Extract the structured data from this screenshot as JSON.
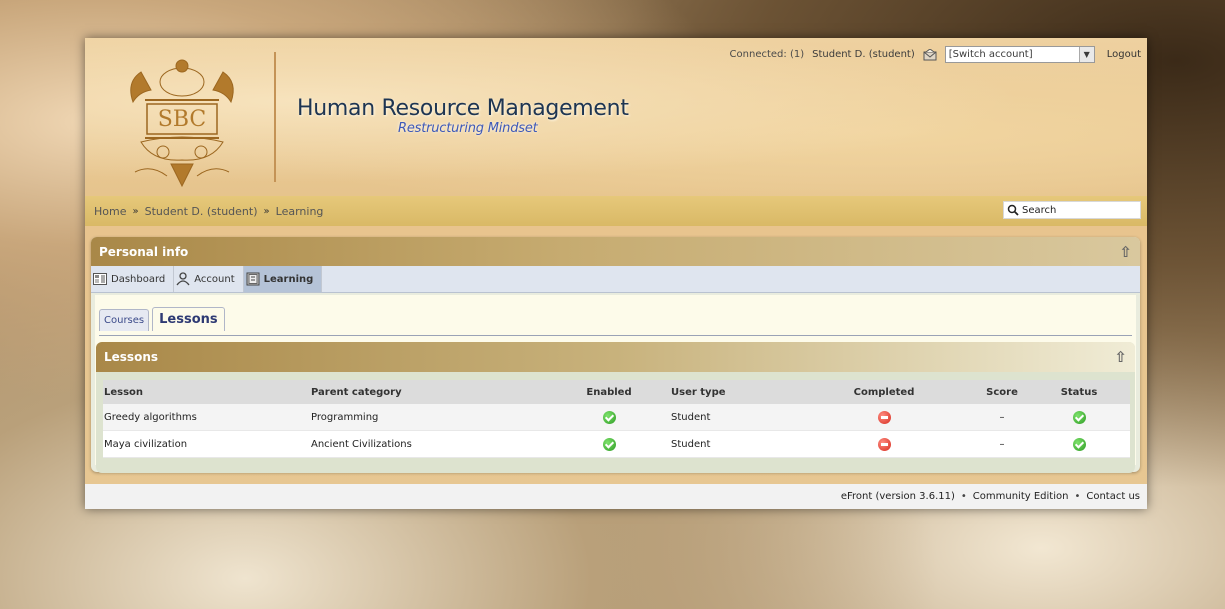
{
  "header": {
    "logo_text": "SBC",
    "site_title": "Human Resource Management",
    "site_subtitle": "Restructuring Mindset",
    "connected_text": "Connected: (1)",
    "user_label": "Student D. (student)",
    "switch_account_value": "[Switch account]",
    "logout_label": "Logout"
  },
  "breadcrumb": {
    "items": [
      "Home",
      "Student D. (student)",
      "Learning"
    ],
    "separator": "»"
  },
  "search": {
    "placeholder": "Search"
  },
  "panel": {
    "title": "Personal info",
    "collapse_icon": "⇧",
    "nav": [
      {
        "label": "Dashboard",
        "icon": "dashboard-icon"
      },
      {
        "label": "Account",
        "icon": "user-icon"
      },
      {
        "label": "Learning",
        "icon": "book-icon",
        "active": true
      }
    ]
  },
  "tabs": [
    {
      "label": "Courses",
      "active": false
    },
    {
      "label": "Lessons",
      "active": true
    }
  ],
  "lessons": {
    "title": "Lessons",
    "collapse_icon": "⇧",
    "columns": [
      "Lesson",
      "Parent category",
      "Enabled",
      "User type",
      "Completed",
      "Score",
      "Status"
    ],
    "rows": [
      {
        "lesson": "Greedy algorithms",
        "category": "Programming",
        "enabled": "ok",
        "user_type": "Student",
        "completed": "no",
        "score": "–",
        "status": "ok"
      },
      {
        "lesson": "Maya civilization",
        "category": "Ancient Civilizations",
        "enabled": "ok",
        "user_type": "Student",
        "completed": "no",
        "score": "–",
        "status": "ok"
      }
    ]
  },
  "footer": {
    "version": "eFront (version 3.6.11)",
    "edition": "Community Edition",
    "contact": "Contact us",
    "separator": "•"
  },
  "colors": {
    "panel_header": "#a98848",
    "active_nav": "#b5c3d7",
    "ok_green": "#2d9a23",
    "no_red": "#d62b1e"
  }
}
